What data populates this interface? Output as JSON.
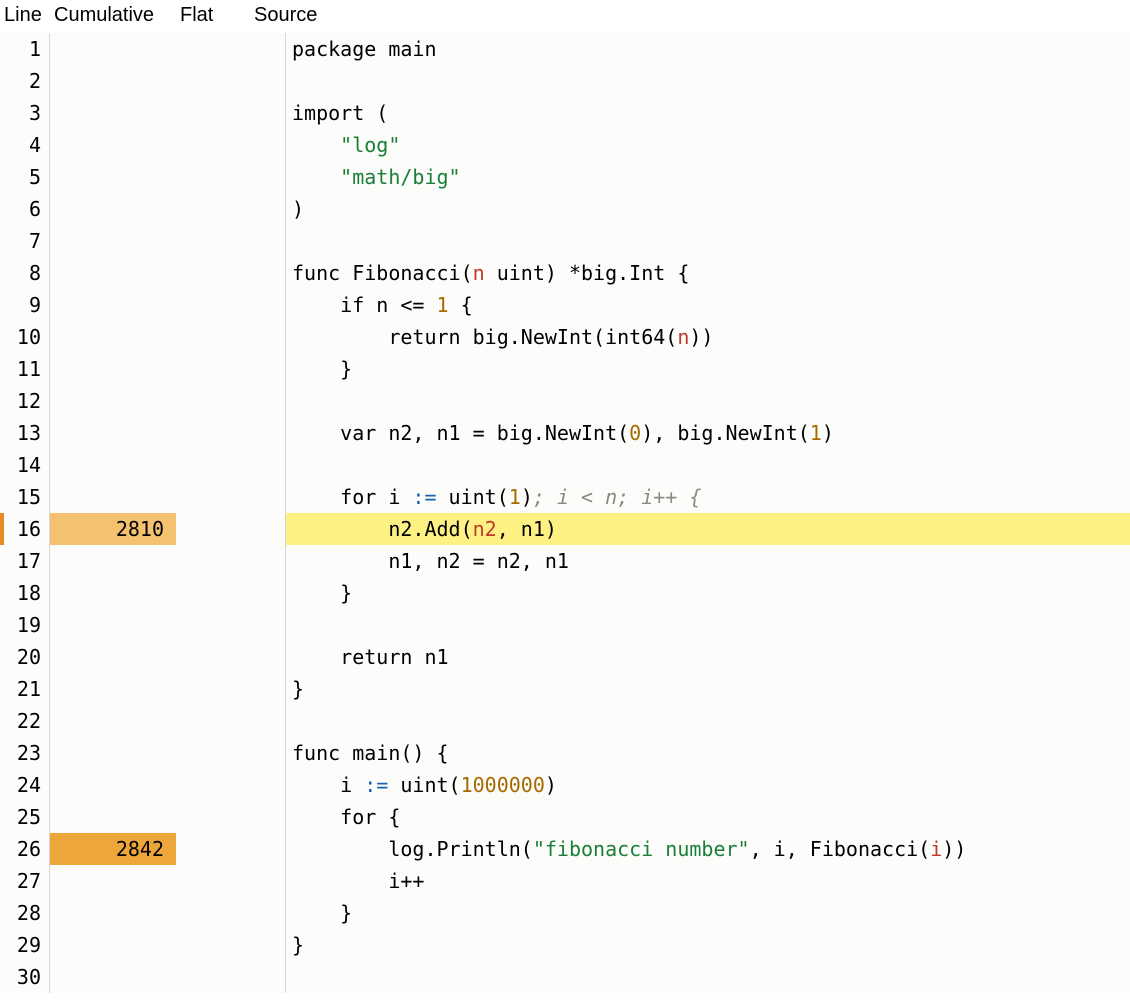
{
  "columns": {
    "line": "Line",
    "cumulative": "Cumulative",
    "flat": "Flat",
    "source": "Source"
  },
  "colors": {
    "heat1": "#f4c171",
    "heat2": "#eda639",
    "highlight": "#fdf184",
    "marker": "#e78b23"
  },
  "rows": [
    {
      "n": 1,
      "cum": "",
      "flat": "",
      "current": false,
      "marked": false,
      "heat": 0,
      "src": [
        [
          "package main",
          ""
        ]
      ]
    },
    {
      "n": 2,
      "cum": "",
      "flat": "",
      "current": false,
      "marked": false,
      "heat": 0,
      "src": [
        [
          "",
          ""
        ]
      ]
    },
    {
      "n": 3,
      "cum": "",
      "flat": "",
      "current": false,
      "marked": false,
      "heat": 0,
      "src": [
        [
          "import (",
          ""
        ]
      ]
    },
    {
      "n": 4,
      "cum": "",
      "flat": "",
      "current": false,
      "marked": false,
      "heat": 0,
      "src": [
        [
          "    ",
          ""
        ],
        [
          "\"log\"",
          "tok-str"
        ]
      ]
    },
    {
      "n": 5,
      "cum": "",
      "flat": "",
      "current": false,
      "marked": false,
      "heat": 0,
      "src": [
        [
          "    ",
          ""
        ],
        [
          "\"math/big\"",
          "tok-str"
        ]
      ]
    },
    {
      "n": 6,
      "cum": "",
      "flat": "",
      "current": false,
      "marked": false,
      "heat": 0,
      "src": [
        [
          ")",
          ""
        ]
      ]
    },
    {
      "n": 7,
      "cum": "",
      "flat": "",
      "current": false,
      "marked": false,
      "heat": 0,
      "src": [
        [
          "",
          ""
        ]
      ]
    },
    {
      "n": 8,
      "cum": "",
      "flat": "",
      "current": false,
      "marked": false,
      "heat": 0,
      "src": [
        [
          "func Fibonacci(",
          ""
        ],
        [
          "n",
          "tok-param"
        ],
        [
          " uint) *big.Int {",
          ""
        ]
      ]
    },
    {
      "n": 9,
      "cum": "",
      "flat": "",
      "current": false,
      "marked": false,
      "heat": 0,
      "src": [
        [
          "    if n <= ",
          ""
        ],
        [
          "1",
          "tok-num"
        ],
        [
          " {",
          ""
        ]
      ]
    },
    {
      "n": 10,
      "cum": "",
      "flat": "",
      "current": false,
      "marked": false,
      "heat": 0,
      "src": [
        [
          "        return big.NewInt(",
          ""
        ],
        [
          "int64",
          "tok-type"
        ],
        [
          "(",
          ""
        ],
        [
          "n",
          "tok-param"
        ],
        [
          "))",
          ""
        ]
      ]
    },
    {
      "n": 11,
      "cum": "",
      "flat": "",
      "current": false,
      "marked": false,
      "heat": 0,
      "src": [
        [
          "    }",
          ""
        ]
      ]
    },
    {
      "n": 12,
      "cum": "",
      "flat": "",
      "current": false,
      "marked": false,
      "heat": 0,
      "src": [
        [
          "",
          ""
        ]
      ]
    },
    {
      "n": 13,
      "cum": "",
      "flat": "",
      "current": false,
      "marked": false,
      "heat": 0,
      "src": [
        [
          "    var n2, n1 = big.NewInt(",
          ""
        ],
        [
          "0",
          "tok-num"
        ],
        [
          "), big.NewInt(",
          ""
        ],
        [
          "1",
          "tok-num"
        ],
        [
          ")",
          ""
        ]
      ]
    },
    {
      "n": 14,
      "cum": "",
      "flat": "",
      "current": false,
      "marked": false,
      "heat": 0,
      "src": [
        [
          "",
          ""
        ]
      ]
    },
    {
      "n": 15,
      "cum": "",
      "flat": "",
      "current": false,
      "marked": false,
      "heat": 0,
      "src": [
        [
          "    for i ",
          ""
        ],
        [
          ":=",
          "tok-op"
        ],
        [
          " uint(",
          ""
        ],
        [
          "1",
          "tok-num"
        ],
        [
          ")",
          ""
        ],
        [
          "; i < n; i++ {",
          "tok-com"
        ]
      ]
    },
    {
      "n": 16,
      "cum": "2810",
      "flat": "",
      "current": true,
      "marked": true,
      "heat": 1,
      "src": [
        [
          "        n2.Add(",
          ""
        ],
        [
          "n2",
          "tok-param"
        ],
        [
          ", n1)",
          ""
        ]
      ]
    },
    {
      "n": 17,
      "cum": "",
      "flat": "",
      "current": false,
      "marked": false,
      "heat": 0,
      "src": [
        [
          "        n1, n2 = n2, n1",
          ""
        ]
      ]
    },
    {
      "n": 18,
      "cum": "",
      "flat": "",
      "current": false,
      "marked": false,
      "heat": 0,
      "src": [
        [
          "    }",
          ""
        ]
      ]
    },
    {
      "n": 19,
      "cum": "",
      "flat": "",
      "current": false,
      "marked": false,
      "heat": 0,
      "src": [
        [
          "",
          ""
        ]
      ]
    },
    {
      "n": 20,
      "cum": "",
      "flat": "",
      "current": false,
      "marked": false,
      "heat": 0,
      "src": [
        [
          "    return n1",
          ""
        ]
      ]
    },
    {
      "n": 21,
      "cum": "",
      "flat": "",
      "current": false,
      "marked": false,
      "heat": 0,
      "src": [
        [
          "}",
          ""
        ]
      ]
    },
    {
      "n": 22,
      "cum": "",
      "flat": "",
      "current": false,
      "marked": false,
      "heat": 0,
      "src": [
        [
          "",
          ""
        ]
      ]
    },
    {
      "n": 23,
      "cum": "",
      "flat": "",
      "current": false,
      "marked": false,
      "heat": 0,
      "src": [
        [
          "func main() {",
          ""
        ]
      ]
    },
    {
      "n": 24,
      "cum": "",
      "flat": "",
      "current": false,
      "marked": false,
      "heat": 0,
      "src": [
        [
          "    i ",
          ""
        ],
        [
          ":=",
          "tok-op"
        ],
        [
          " uint(",
          ""
        ],
        [
          "1000000",
          "tok-num"
        ],
        [
          ")",
          ""
        ]
      ]
    },
    {
      "n": 25,
      "cum": "",
      "flat": "",
      "current": false,
      "marked": false,
      "heat": 0,
      "src": [
        [
          "    for {",
          ""
        ]
      ]
    },
    {
      "n": 26,
      "cum": "2842",
      "flat": "",
      "current": false,
      "marked": false,
      "heat": 2,
      "src": [
        [
          "        log.Println(",
          ""
        ],
        [
          "\"fibonacci number\"",
          "tok-str"
        ],
        [
          ", i, Fibonacci(",
          ""
        ],
        [
          "i",
          "tok-param"
        ],
        [
          "))",
          ""
        ]
      ]
    },
    {
      "n": 27,
      "cum": "",
      "flat": "",
      "current": false,
      "marked": false,
      "heat": 0,
      "src": [
        [
          "        i++",
          ""
        ]
      ]
    },
    {
      "n": 28,
      "cum": "",
      "flat": "",
      "current": false,
      "marked": false,
      "heat": 0,
      "src": [
        [
          "    }",
          ""
        ]
      ]
    },
    {
      "n": 29,
      "cum": "",
      "flat": "",
      "current": false,
      "marked": false,
      "heat": 0,
      "src": [
        [
          "}",
          ""
        ]
      ]
    },
    {
      "n": 30,
      "cum": "",
      "flat": "",
      "current": false,
      "marked": false,
      "heat": 0,
      "src": [
        [
          "",
          ""
        ]
      ]
    }
  ]
}
